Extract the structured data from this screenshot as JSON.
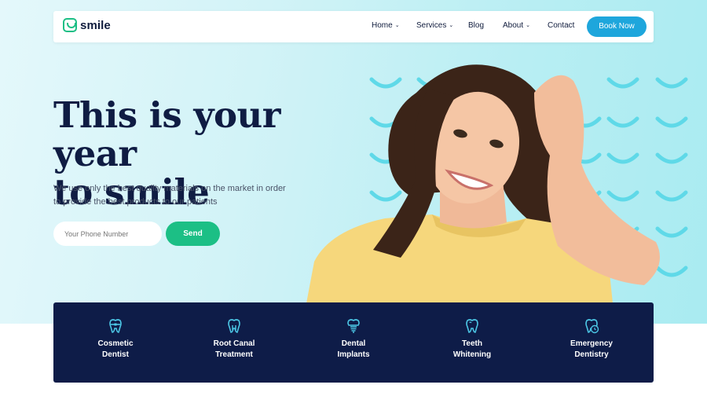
{
  "brand": {
    "name": "smile",
    "accent": "#1cbf85",
    "button_blue": "#1ea6dc",
    "navy": "#0e1c48"
  },
  "nav": {
    "items": [
      {
        "label": "Home",
        "has_dropdown": true
      },
      {
        "label": "Services",
        "has_dropdown": true
      },
      {
        "label": "Blog",
        "has_dropdown": false
      },
      {
        "label": "About",
        "has_dropdown": true
      },
      {
        "label": "Contact",
        "has_dropdown": false
      }
    ],
    "cta": "Book Now",
    "dropdown_icon": "chevron-down-icon"
  },
  "hero": {
    "headline_line1": "This is your year",
    "headline_line2": "to smile",
    "sub_line1": "We use only the best quality materials on the market in order",
    "sub_line2": "to provide the best products to our patients",
    "phone_placeholder": "Your Phone Number",
    "send_label": "Send"
  },
  "services": [
    {
      "line1": "Cosmetic",
      "line2": "Dentist",
      "icon": "tooth-braces-icon"
    },
    {
      "line1": "Root Canal",
      "line2": "Treatment",
      "icon": "tooth-icon"
    },
    {
      "line1": "Dental",
      "line2": "Implants",
      "icon": "tooth-implant-icon"
    },
    {
      "line1": "Teeth",
      "line2": "Whitening",
      "icon": "tooth-whitening-icon"
    },
    {
      "line1": "Emergency",
      "line2": "Dentistry",
      "icon": "tooth-clock-icon"
    }
  ]
}
